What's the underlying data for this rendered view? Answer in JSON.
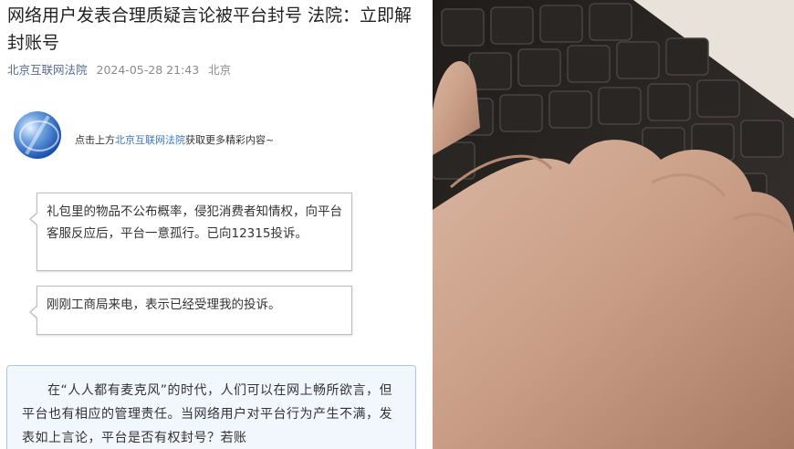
{
  "article": {
    "title": "网络用户发表合理质疑言论被平台封号 法院：立即解封账号",
    "author": "北京互联网法院",
    "datetime": "2024-05-28 21:43",
    "location": "北京",
    "promo_prefix": "点击上方",
    "promo_link": "北京互联网法院",
    "promo_suffix": "获取更多精彩内容~"
  },
  "messages": [
    {
      "text": "礼包里的物品不公布概率，侵犯消费者知情权，向平台客服反应后，平台一意孤行。已向12315投诉。"
    },
    {
      "text": "刚刚工商局来电，表示已经受理我的投诉。"
    }
  ],
  "quote": {
    "text": "在“人人都有麦克风”的时代，人们可以在网上畅所欲言，但平台也有相应的管理责任。当网络用户对平台行为产生不满，发表如上言论，平台是否有权封号？若账"
  },
  "photo": {
    "icon": "keyboard-typing-photo"
  }
}
